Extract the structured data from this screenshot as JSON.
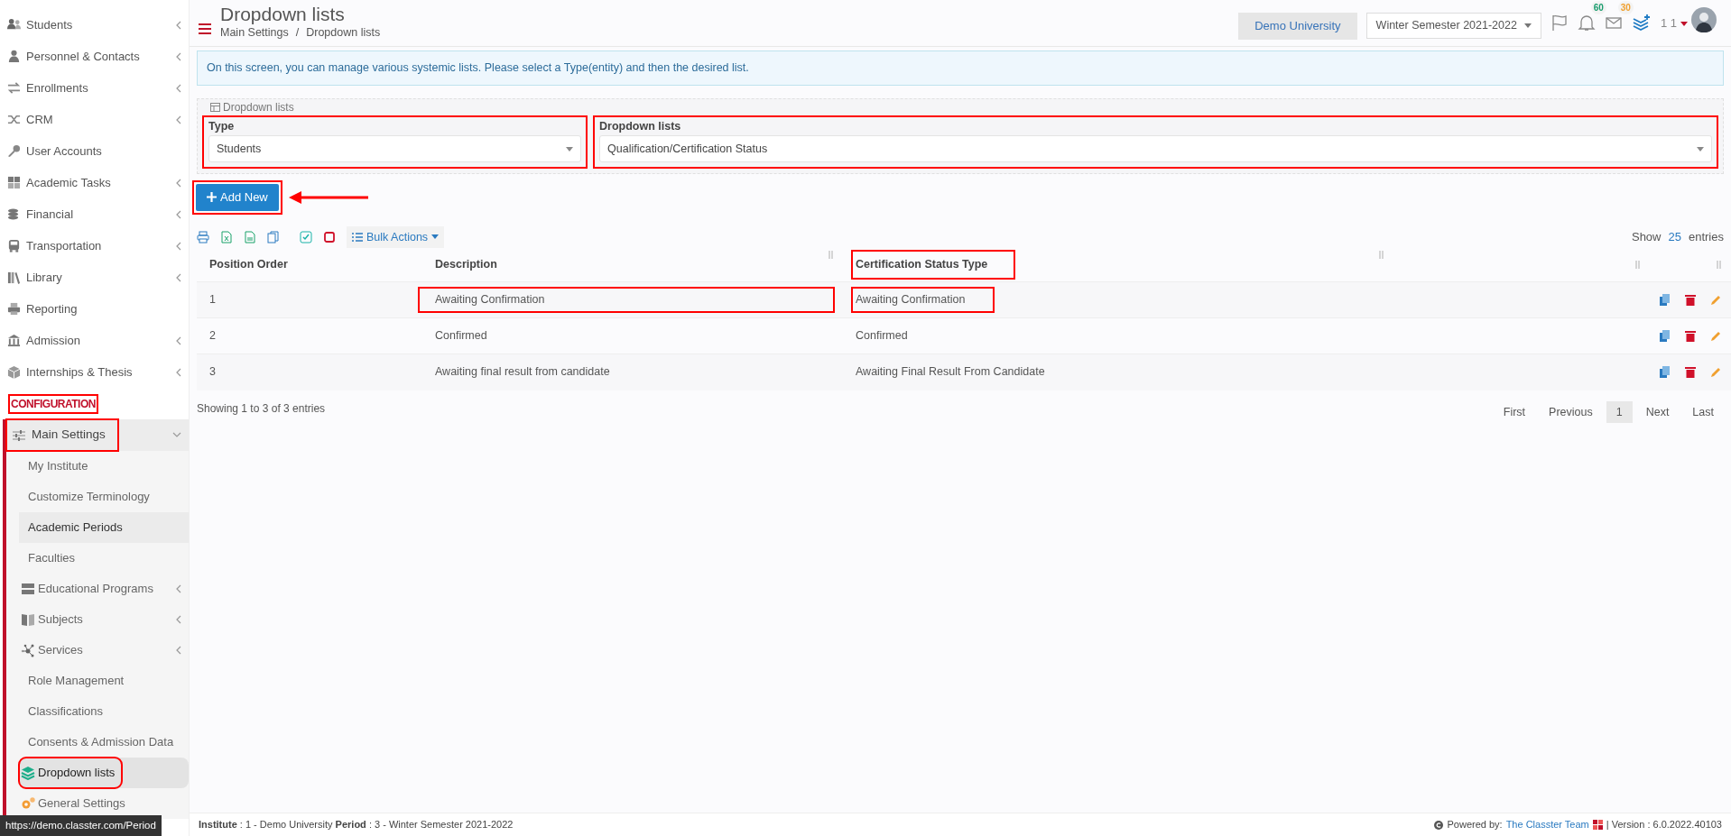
{
  "sidebar": {
    "items": [
      {
        "label": "Students",
        "kind": "users",
        "caret": true
      },
      {
        "label": "Personnel & Contacts",
        "kind": "person",
        "caret": true
      },
      {
        "label": "Enrollments",
        "kind": "exchange",
        "caret": true
      },
      {
        "label": "CRM",
        "kind": "shuffle",
        "caret": true
      },
      {
        "label": "User Accounts",
        "kind": "key",
        "caret": false
      },
      {
        "label": "Academic Tasks",
        "kind": "grid",
        "caret": true
      },
      {
        "label": "Financial",
        "kind": "coins",
        "caret": true
      },
      {
        "label": "Transportation",
        "kind": "bus",
        "caret": true
      },
      {
        "label": "Library",
        "kind": "books",
        "caret": true
      },
      {
        "label": "Reporting",
        "kind": "printer",
        "caret": false
      },
      {
        "label": "Admission",
        "kind": "bank",
        "caret": true
      },
      {
        "label": "Internships & Thesis",
        "kind": "cube",
        "caret": true
      }
    ],
    "section": {
      "label": "CONFIGURATION",
      "highlighted": true
    },
    "group": {
      "label": "Main Settings",
      "kind": "sliders",
      "expanded": true,
      "highlighted": true,
      "children": [
        {
          "label": "My Institute",
          "kind": "plain",
          "caret": false,
          "selected": false,
          "hovered": false,
          "highlighted": false
        },
        {
          "label": "Customize Terminology",
          "kind": "plain",
          "caret": false,
          "selected": false,
          "hovered": false,
          "highlighted": false
        },
        {
          "label": "Academic Periods",
          "kind": "plain",
          "caret": false,
          "selected": false,
          "hovered": true,
          "highlighted": false
        },
        {
          "label": "Faculties",
          "kind": "plain",
          "caret": false,
          "selected": false,
          "hovered": false,
          "highlighted": false
        },
        {
          "label": "Educational Programs",
          "kind": "server",
          "caret": true,
          "selected": false,
          "hovered": false,
          "highlighted": false
        },
        {
          "label": "Subjects",
          "kind": "book",
          "caret": true,
          "selected": false,
          "hovered": false,
          "highlighted": false
        },
        {
          "label": "Services",
          "kind": "network",
          "caret": true,
          "selected": false,
          "hovered": false,
          "highlighted": false
        },
        {
          "label": "Role Management",
          "kind": "plain",
          "caret": false,
          "selected": false,
          "hovered": false,
          "highlighted": false
        },
        {
          "label": "Classifications",
          "kind": "plain",
          "caret": false,
          "selected": false,
          "hovered": false,
          "highlighted": false
        },
        {
          "label": "Consents & Admission Data",
          "kind": "plain",
          "caret": false,
          "selected": false,
          "hovered": false,
          "highlighted": false
        },
        {
          "label": "Dropdown lists",
          "kind": "layers",
          "caret": false,
          "selected": true,
          "hovered": false,
          "highlighted": true
        },
        {
          "label": "General Settings",
          "kind": "gears",
          "caret": false,
          "selected": false,
          "hovered": false,
          "highlighted": false
        }
      ]
    }
  },
  "status_url": "https://demo.classter.com/Period",
  "header": {
    "title": "Dropdown lists",
    "breadcrumbs": [
      "Main Settings",
      "Dropdown lists"
    ],
    "separator": "/",
    "institution": "Demo University",
    "period": "Winter Semester 2021-2022",
    "notifications": "60",
    "messages": "30",
    "user": "1 1"
  },
  "info": "On this screen, you can manage various systemic lists. Please select a Type(entity) and then the desired list.",
  "filters": {
    "legend": "Dropdown lists",
    "fields": [
      {
        "label": "Type",
        "value": "Students",
        "highlighted": true,
        "caret": true
      },
      {
        "label": "Dropdown lists",
        "value": "Qualification/Certification Status",
        "highlighted": true,
        "caret": true
      }
    ]
  },
  "add_button": {
    "label": "Add New",
    "highlighted": true,
    "arrow": true
  },
  "toolbar": {
    "bulk_label": "Bulk Actions",
    "show_label": "Show",
    "page_size": "25",
    "entries_label": "entries"
  },
  "table": {
    "columns": [
      {
        "label": "Position Order",
        "highlighted": false
      },
      {
        "label": "Description",
        "highlighted": false
      },
      {
        "label": "Certification Status Type",
        "highlighted": true
      }
    ],
    "rows": [
      {
        "cells": [
          {
            "text": "1",
            "highlighted": false
          },
          {
            "text": "Awaiting Confirmation",
            "highlighted": true
          },
          {
            "text": "Awaiting Confirmation",
            "highlighted": true
          }
        ]
      },
      {
        "cells": [
          {
            "text": "2",
            "highlighted": false
          },
          {
            "text": "Confirmed",
            "highlighted": false
          },
          {
            "text": "Confirmed",
            "highlighted": false
          }
        ]
      },
      {
        "cells": [
          {
            "text": "3",
            "highlighted": false
          },
          {
            "text": "Awaiting final result from candidate",
            "highlighted": false
          },
          {
            "text": "Awaiting Final Result From Candidate",
            "highlighted": false
          }
        ]
      }
    ],
    "summary": "Showing 1 to 3 of 3 entries",
    "pagination": [
      {
        "label": "First",
        "selected": false
      },
      {
        "label": "Previous",
        "selected": false
      },
      {
        "label": "1",
        "selected": true
      },
      {
        "label": "Next",
        "selected": false
      },
      {
        "label": "Last",
        "selected": false
      }
    ]
  },
  "footer": {
    "context": "**Institute** : 1 - Demo University **Period** : 3 - Winter Semester 2021-2022",
    "powered": "Powered by:",
    "team": "The Classter Team",
    "version": "| Version : 6.0.2022.40103"
  }
}
